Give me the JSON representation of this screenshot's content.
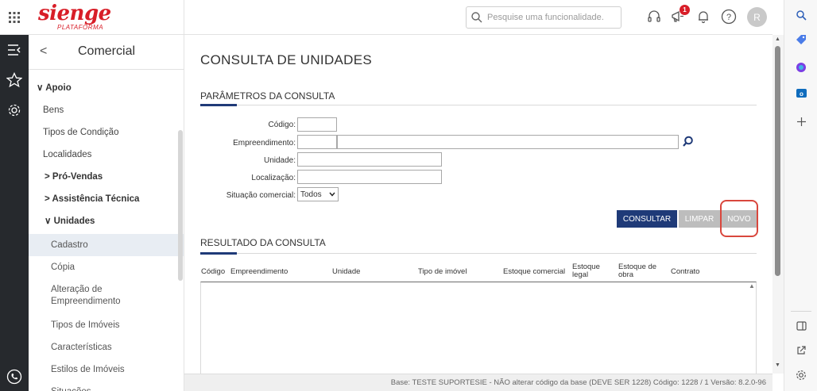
{
  "header": {
    "logo": "sienge",
    "logo_sub": "PLATAFORMA",
    "search_placeholder": "Pesquise uma funcionalidade.",
    "notification_count": "1",
    "avatar_initial": "R"
  },
  "sidebar": {
    "back": "<",
    "title": "Comercial",
    "items": [
      {
        "label": "Apoio",
        "prefix": "∨"
      },
      {
        "label": "Bens"
      },
      {
        "label": "Tipos de Condição"
      },
      {
        "label": "Localidades"
      },
      {
        "label": "Pró-Vendas",
        "prefix": ">"
      },
      {
        "label": "Assistência Técnica",
        "prefix": ">"
      },
      {
        "label": "Unidades",
        "prefix": "∨"
      },
      {
        "label": "Cadastro"
      },
      {
        "label": "Cópia"
      },
      {
        "label": "Alteração de Empreendimento"
      },
      {
        "label": "Tipos de Imóveis"
      },
      {
        "label": "Características"
      },
      {
        "label": "Estilos de Imóveis"
      },
      {
        "label": "Situações"
      }
    ]
  },
  "main": {
    "page_title": "CONSULTA DE UNIDADES",
    "params_title": "PARÂMETROS DA CONSULTA",
    "labels": {
      "codigo": "Código:",
      "empreendimento": "Empreendimento:",
      "unidade": "Unidade:",
      "localizacao": "Localização:",
      "situacao": "Situação comercial:"
    },
    "situacao_selected": "Todos",
    "buttons": {
      "consultar": "CONSULTAR",
      "limpar": "LIMPAR",
      "novo": "NOVO"
    },
    "result_title": "RESULTADO DA CONSULTA",
    "columns": [
      "Código",
      "Empreendimento",
      "Unidade",
      "Tipo de imóvel",
      "Estoque comercial",
      "Estoque legal",
      "Estoque de obra",
      "Contrato"
    ]
  },
  "status_bar": "Base: TESTE SUPORTESIE - NÃO alterar código da base (DEVE SER 1228)  Código: 1228 / 1  Versão: 8.2.0-96",
  "colors": {
    "brand": "#d81e28",
    "primary": "#1f3a78",
    "rail": "#26292d",
    "highlight": "#d9473d"
  }
}
